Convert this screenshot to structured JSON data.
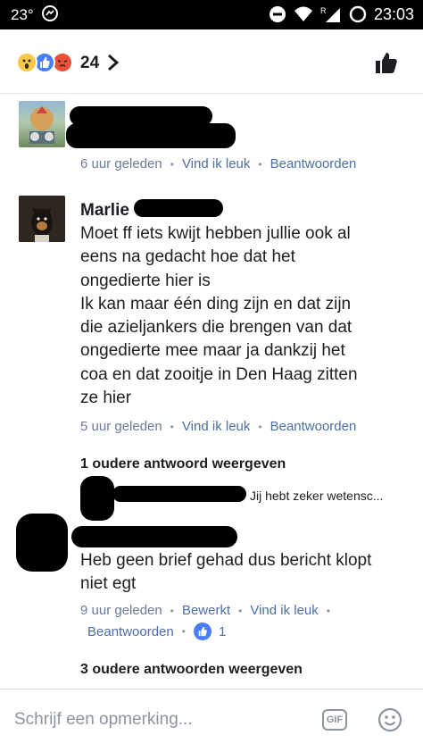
{
  "status_bar": {
    "temperature": "23°",
    "time": "23:03",
    "network_label": "R"
  },
  "reactions": {
    "count": "24",
    "types": [
      "wow",
      "like",
      "angry"
    ]
  },
  "comments": [
    {
      "author": "",
      "text": "",
      "time": "6 uur geleden",
      "like_label": "Vind ik leuk",
      "reply_label": "Beantwoorden"
    },
    {
      "author": "Marlie",
      "text_lines": [
        "Moet ff iets kwijt hebben jullie ook al",
        "eens na gedacht hoe dat het",
        "ongedierte hier is",
        "Ik kan maar één ding zijn en dat zijn",
        "die azieljankers die brengen van dat",
        "ongedierte mee maar ja dankzij het",
        "coa en dat zooitje in Den Haag zitten",
        "ze hier"
      ],
      "time": "5 uur geleden",
      "like_label": "Vind ik leuk",
      "reply_label": "Beantwoorden",
      "more_replies": "1 oudere antwoord weergeven",
      "reply_preview": "Jij hebt zeker wetensc...",
      "reply": {
        "text_lines": [
          "Heb geen brief gehad dus bericht klopt",
          "niet egt"
        ],
        "time": "9 uur geleden",
        "edited_label": "Bewerkt",
        "like_label": "Vind ik leuk",
        "reply_label": "Beantwoorden",
        "like_count": "1"
      }
    }
  ],
  "more_replies_2": "3 oudere antwoorden weergeven",
  "composer": {
    "placeholder": "Schrijf een opmerking...",
    "gif_label": "GIF"
  },
  "colors": {
    "like_blue": "#4a7ef5",
    "link": "#4b6fa6",
    "meta_gray": "#6a7a99"
  }
}
